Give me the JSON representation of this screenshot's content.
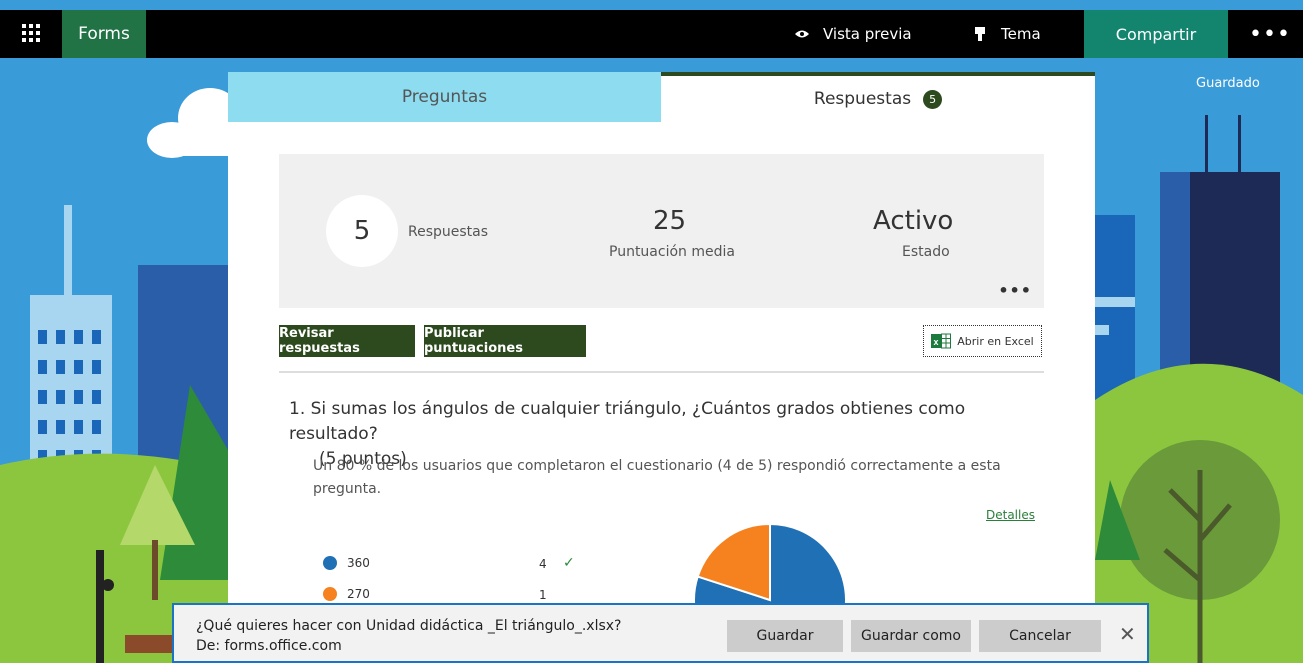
{
  "topbar": {
    "app_name": "Forms",
    "preview_label": "Vista previa",
    "theme_label": "Tema",
    "share_label": "Compartir",
    "more_label": "•••",
    "saved_label": "Guardado"
  },
  "tabs": {
    "questions_label": "Preguntas",
    "responses_label": "Respuestas",
    "responses_badge": "5"
  },
  "stats": {
    "responses_count": "5",
    "responses_label": "Respuestas",
    "avg_score": "25",
    "avg_score_label": "Puntuación media",
    "status": "Activo",
    "status_label": "Estado",
    "more_label": "•••"
  },
  "actions": {
    "review_label": "Revisar respuestas",
    "publish_label": "Publicar puntuaciones",
    "excel_label": "Abrir en Excel"
  },
  "question": {
    "title_line1": "1.  Si sumas los ángulos de cualquier triángulo, ¿Cuántos grados obtienes como resultado?",
    "title_line2": "(5 puntos)",
    "description": "Un 80 % de los usuarios que completaron el cuestionario (4 de 5) respondió correctamente a esta pregunta.",
    "details_label": "Detalles",
    "answers": [
      {
        "label": "360",
        "count": "4",
        "correct": true,
        "color": "#1f70b5"
      },
      {
        "label": "270",
        "count": "1",
        "correct": false,
        "color": "#f5821f"
      }
    ]
  },
  "chart_data": {
    "type": "pie",
    "categories": [
      "360",
      "270"
    ],
    "values": [
      4,
      1
    ]
  },
  "download_bar": {
    "message": "¿Qué quieres hacer con Unidad didáctica _El triángulo_.xlsx?",
    "source": "De: forms.office.com",
    "save_label": "Guardar",
    "save_as_label": "Guardar como",
    "cancel_label": "Cancelar",
    "close_label": "✕"
  }
}
